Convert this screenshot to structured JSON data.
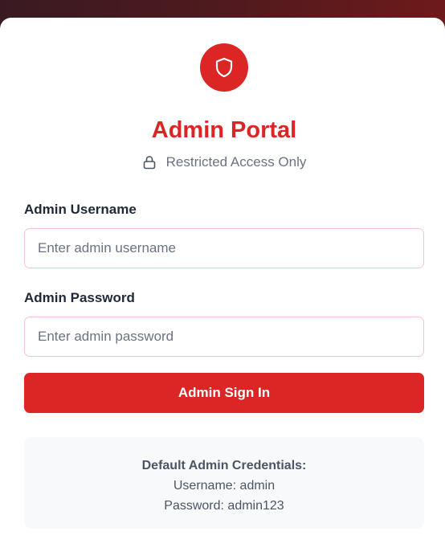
{
  "header": {
    "title": "Admin Portal",
    "subtitle": "Restricted Access Only"
  },
  "form": {
    "username_label": "Admin Username",
    "username_placeholder": "Enter admin username",
    "username_value": "",
    "password_label": "Admin Password",
    "password_placeholder": "Enter admin password",
    "password_value": "",
    "submit_label": "Admin Sign In"
  },
  "credentials": {
    "title": "Default Admin Credentials:",
    "username_line": "Username: admin",
    "password_line": "Password: admin123"
  },
  "icons": {
    "logo": "shield-icon",
    "subtitle": "lock-icon"
  },
  "colors": {
    "accent": "#dc2626",
    "input_border": "#f4c7c7",
    "muted_text": "#6b7280",
    "panel_bg": "#f8f9fb"
  }
}
